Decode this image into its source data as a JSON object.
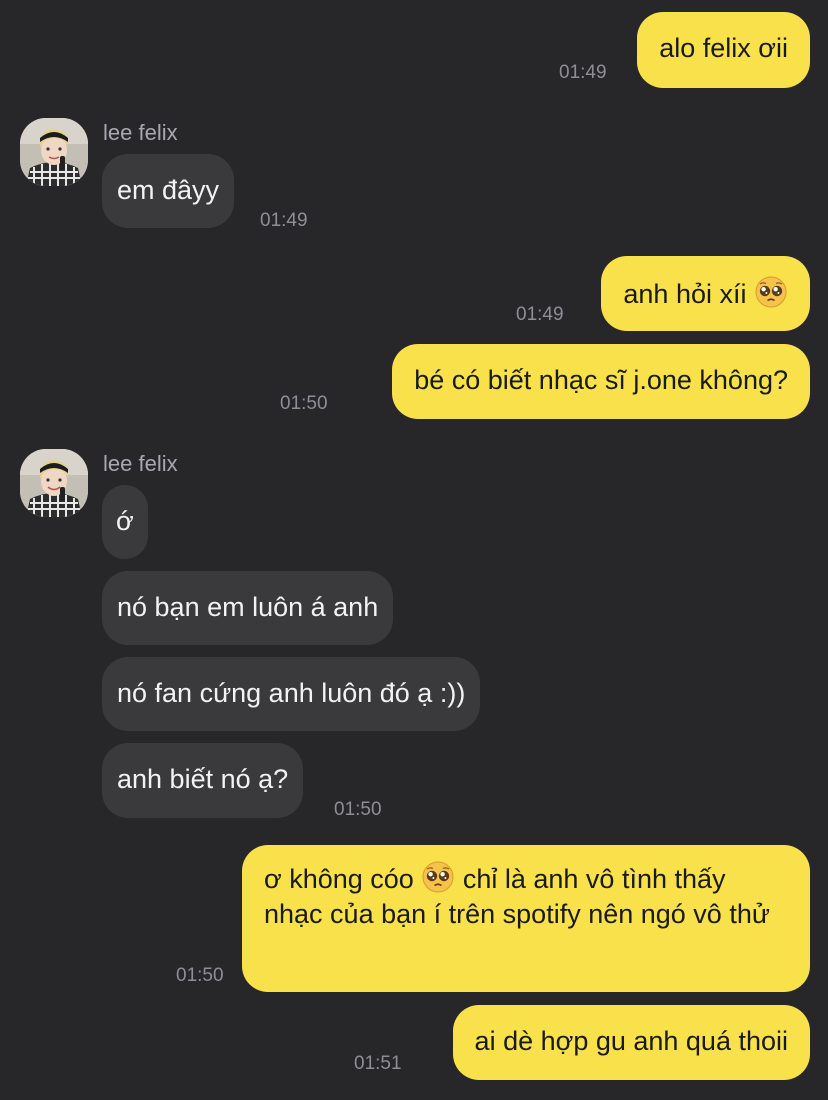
{
  "contact": {
    "name": "lee felix",
    "avatar_icon": "profile-photo-icon"
  },
  "messages": [
    {
      "side": "out",
      "text": "alo felix ơii",
      "time": "01:49"
    },
    {
      "side": "in",
      "text": "em đâyy",
      "time": "01:49"
    },
    {
      "side": "out",
      "text_before_emoji": "anh hỏi xíi",
      "emoji": "pleading-face-icon",
      "time": "01:49"
    },
    {
      "side": "out",
      "text": "bé có biết nhạc sĩ j.one không?",
      "time": "01:50"
    },
    {
      "side": "in",
      "text": "ớ"
    },
    {
      "side": "in",
      "text": "nó bạn em luôn á anh"
    },
    {
      "side": "in",
      "text": "nó fan cứng anh luôn đó ạ :))"
    },
    {
      "side": "in",
      "text": "anh biết nó ạ?",
      "time": "01:50"
    },
    {
      "side": "out",
      "text_before_emoji": "ơ không cóo",
      "emoji": "pleading-face-icon",
      "text_after_emoji": "chỉ là anh vô tình thấy nhạc của bạn í trên spotify nên ngó vô thử",
      "time": "01:50"
    },
    {
      "side": "out",
      "text": "ai dè hợp gu anh quá thoii",
      "time": "01:51"
    }
  ],
  "colors": {
    "background": "#27272a",
    "outgoing_bubble": "#f9e14b",
    "incoming_bubble": "#3a3a3c",
    "timestamp": "#8e8e93"
  }
}
